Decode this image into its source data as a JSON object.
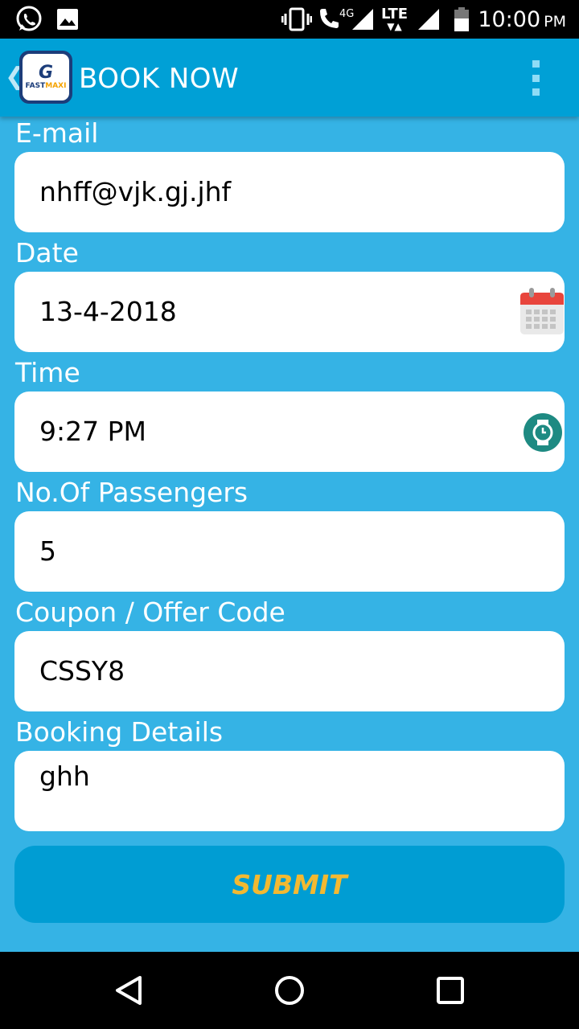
{
  "status_bar": {
    "time": "10:00",
    "ampm": "PM",
    "icons": [
      "whatsapp-icon",
      "gallery-icon",
      "vibrate-icon",
      "volte-call-4g-icon",
      "signal-icon",
      "lte-icon",
      "signal-icon-2",
      "battery-icon"
    ],
    "network_label": "4G",
    "lte_label": "LTE"
  },
  "app_bar": {
    "title": "BOOK NOW",
    "back_icon": "chevron-left-icon",
    "logo_text_a": "FAST",
    "logo_text_b": "MAXI",
    "logo_mark": "G",
    "menu_icon": "overflow-menu-icon"
  },
  "form": {
    "email": {
      "label": "E-mail",
      "value": "nhff@vjk.gj.jhf"
    },
    "date": {
      "label": "Date",
      "value": "13-4-2018",
      "icon": "calendar-icon"
    },
    "time": {
      "label": "Time",
      "value": "9:27 PM",
      "icon": "clock-icon"
    },
    "passengers": {
      "label": "No.Of Passengers",
      "value": "5"
    },
    "coupon": {
      "label": "Coupon / Offer Code",
      "value": "CSSY8"
    },
    "details": {
      "label": "Booking Details",
      "value": "ghh"
    },
    "submit_label": "SUBMIT"
  },
  "nav_bar": {
    "back": "back-triangle-icon",
    "home": "home-circle-icon",
    "recents": "recents-square-icon"
  },
  "colors": {
    "background": "#35b3e5",
    "app_bar": "#00a0d6",
    "submit_bg": "#009dd3",
    "submit_text": "#f3b931"
  }
}
